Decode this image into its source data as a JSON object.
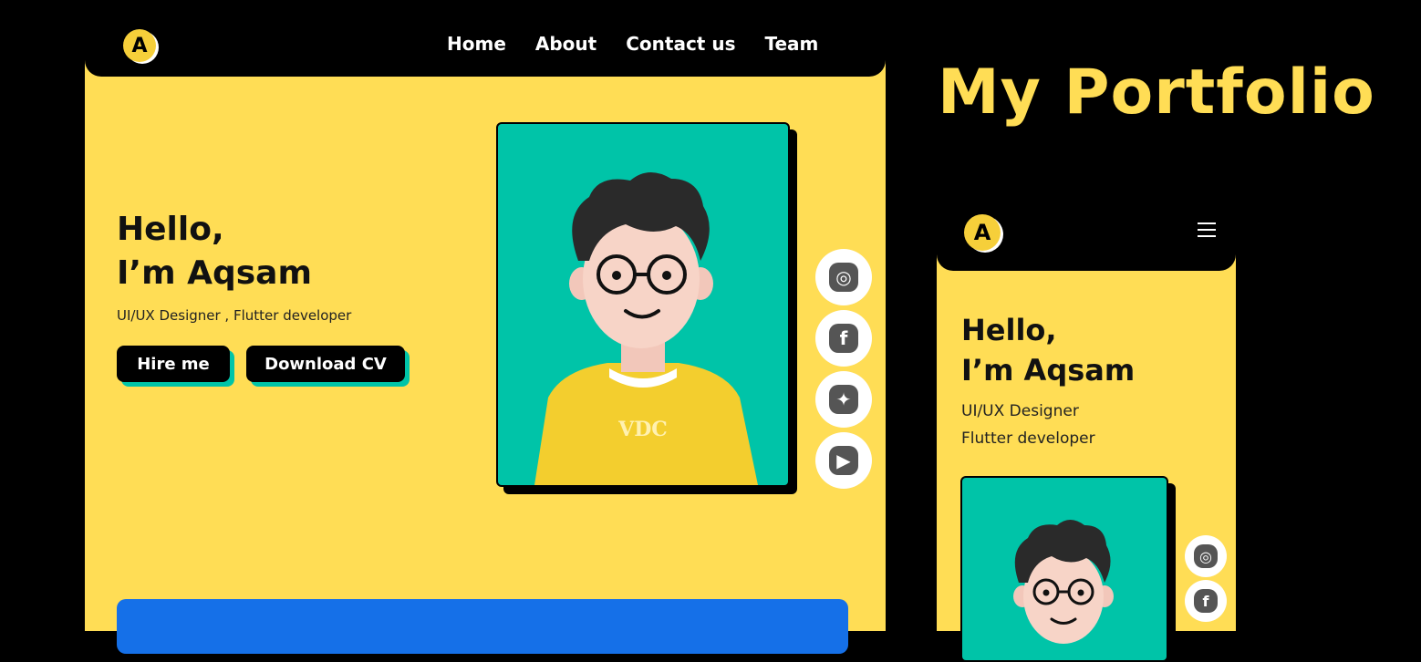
{
  "page_title": "My Portfolio",
  "desktop": {
    "logo_letter": "A",
    "nav": [
      "Home",
      "About",
      "Contact us",
      "Team"
    ],
    "greeting_line1": "Hello,",
    "greeting_line2": "I’m Aqsam",
    "role": "UI/UX Designer , Flutter developer",
    "buttons": {
      "hire": "Hire me",
      "cv": "Download CV"
    },
    "shirt_text": "VDC",
    "social_icons": [
      "instagram-icon",
      "facebook-icon",
      "twitter-icon",
      "youtube-icon"
    ]
  },
  "mobile": {
    "logo_letter": "A",
    "greeting_line1": "Hello,",
    "greeting_line2": "I’m Aqsam",
    "role_line1": "UI/UX Designer",
    "role_line2": "Flutter developer",
    "social_icons": [
      "instagram-icon",
      "facebook-icon"
    ]
  },
  "colors": {
    "background": "#000000",
    "brand_yellow": "#FFDD55",
    "accent_teal": "#00C4A8",
    "accent_blue": "#1570E8"
  }
}
